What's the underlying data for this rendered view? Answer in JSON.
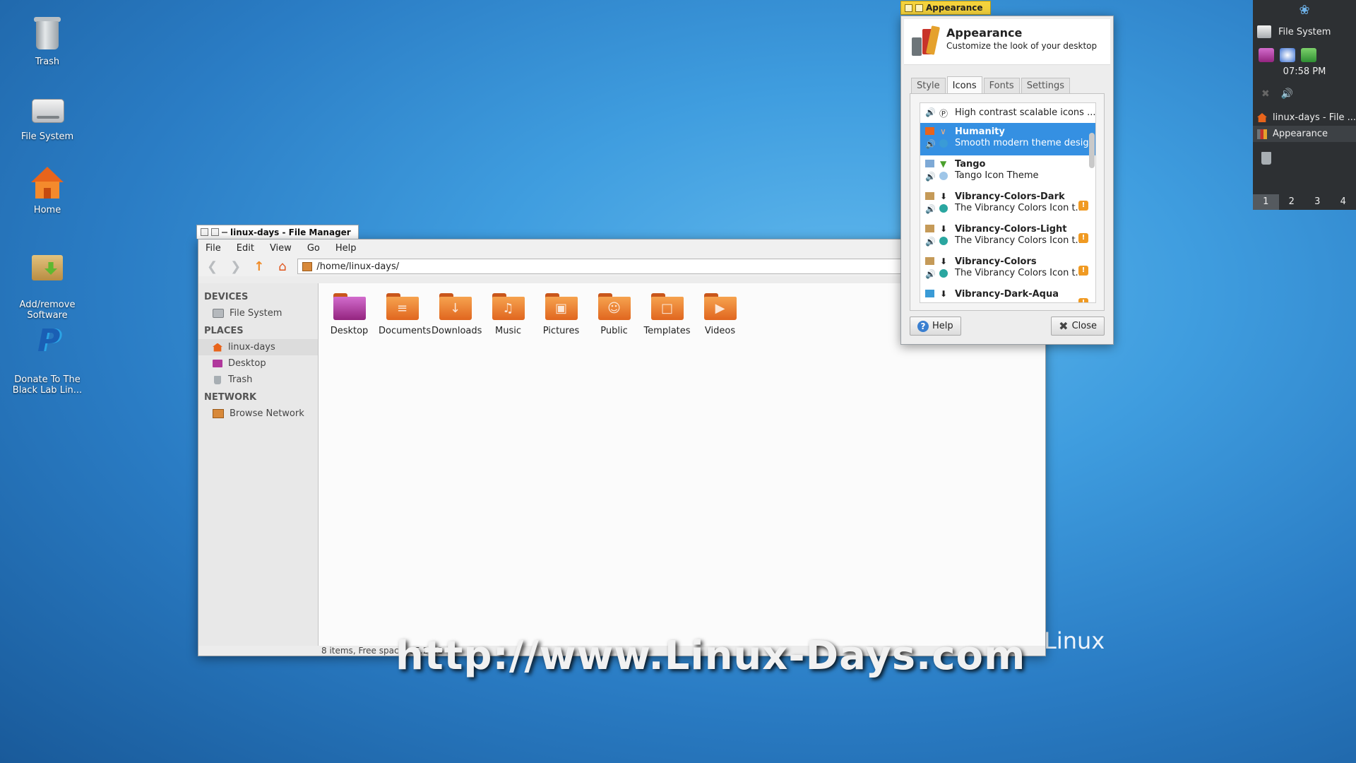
{
  "desktop": {
    "icons": [
      {
        "label": "Trash"
      },
      {
        "label": "File System"
      },
      {
        "label": "Home"
      },
      {
        "label": "Add/remove\nSoftware"
      },
      {
        "label": "Donate To The\nBlack Lab Lin..."
      }
    ],
    "brand_text": "Linux",
    "watermark": "http://www.Linux-Days.com"
  },
  "file_manager": {
    "title": "linux-days - File Manager",
    "menu": [
      "File",
      "Edit",
      "View",
      "Go",
      "Help"
    ],
    "location": "/home/linux-days/",
    "sidebar": {
      "devices_header": "DEVICES",
      "devices": [
        "File System"
      ],
      "places_header": "PLACES",
      "places": [
        "linux-days",
        "Desktop",
        "Trash"
      ],
      "network_header": "NETWORK",
      "network": [
        "Browse Network"
      ]
    },
    "folders": [
      "Desktop",
      "Documents",
      "Downloads",
      "Music",
      "Pictures",
      "Public",
      "Templates",
      "Videos"
    ],
    "status": "8 items, Free space: 15.2 GB"
  },
  "appearance": {
    "window_title": "Appearance",
    "heading": "Appearance",
    "subtitle": "Customize the look of your desktop",
    "tabs": [
      "Style",
      "Icons",
      "Fonts",
      "Settings"
    ],
    "active_tab": "Icons",
    "themes": [
      {
        "name": "",
        "desc": "High contrast scalable icons ..."
      },
      {
        "name": "Humanity",
        "desc": "Smooth modern theme desig..."
      },
      {
        "name": "Tango",
        "desc": "Tango Icon Theme"
      },
      {
        "name": "Vibrancy-Colors-Dark",
        "desc": "The Vibrancy Colors Icon t..."
      },
      {
        "name": "Vibrancy-Colors-Light",
        "desc": "The Vibrancy Colors Icon t..."
      },
      {
        "name": "Vibrancy-Colors",
        "desc": "The Vibrancy Colors Icon t..."
      },
      {
        "name": "Vibrancy-Dark-Aqua",
        "desc": ""
      }
    ],
    "selected_theme": "Humanity",
    "help_label": "Help",
    "close_label": "Close"
  },
  "panel": {
    "filesystem_label": "File System",
    "clock": "07:58 PM",
    "tasks": [
      "linux-days - File ...",
      "Appearance"
    ],
    "workspaces": [
      "1",
      "2",
      "3",
      "4"
    ],
    "active_workspace": "1"
  },
  "colors": {
    "selection": "#3590e2",
    "titlebar_active": "#f4d23c",
    "folder_orange": "#e8641b"
  }
}
